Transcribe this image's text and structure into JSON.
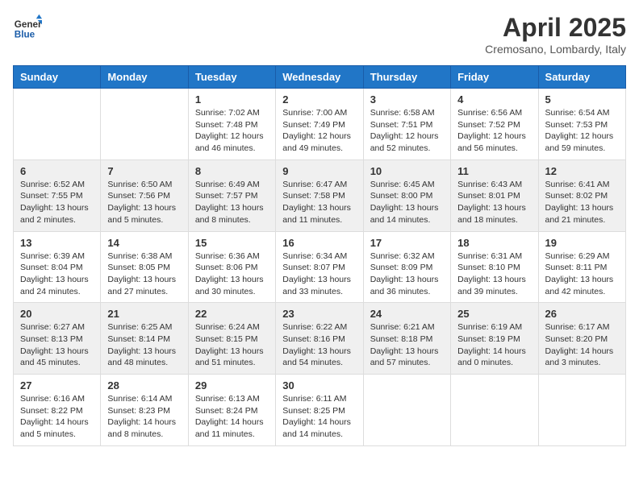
{
  "header": {
    "logo_text_general": "General",
    "logo_text_blue": "Blue",
    "month_title": "April 2025",
    "subtitle": "Cremosano, Lombardy, Italy"
  },
  "days_of_week": [
    "Sunday",
    "Monday",
    "Tuesday",
    "Wednesday",
    "Thursday",
    "Friday",
    "Saturday"
  ],
  "weeks": [
    [
      {
        "day": "",
        "info": ""
      },
      {
        "day": "",
        "info": ""
      },
      {
        "day": "1",
        "info": "Sunrise: 7:02 AM\nSunset: 7:48 PM\nDaylight: 12 hours and 46 minutes."
      },
      {
        "day": "2",
        "info": "Sunrise: 7:00 AM\nSunset: 7:49 PM\nDaylight: 12 hours and 49 minutes."
      },
      {
        "day": "3",
        "info": "Sunrise: 6:58 AM\nSunset: 7:51 PM\nDaylight: 12 hours and 52 minutes."
      },
      {
        "day": "4",
        "info": "Sunrise: 6:56 AM\nSunset: 7:52 PM\nDaylight: 12 hours and 56 minutes."
      },
      {
        "day": "5",
        "info": "Sunrise: 6:54 AM\nSunset: 7:53 PM\nDaylight: 12 hours and 59 minutes."
      }
    ],
    [
      {
        "day": "6",
        "info": "Sunrise: 6:52 AM\nSunset: 7:55 PM\nDaylight: 13 hours and 2 minutes."
      },
      {
        "day": "7",
        "info": "Sunrise: 6:50 AM\nSunset: 7:56 PM\nDaylight: 13 hours and 5 minutes."
      },
      {
        "day": "8",
        "info": "Sunrise: 6:49 AM\nSunset: 7:57 PM\nDaylight: 13 hours and 8 minutes."
      },
      {
        "day": "9",
        "info": "Sunrise: 6:47 AM\nSunset: 7:58 PM\nDaylight: 13 hours and 11 minutes."
      },
      {
        "day": "10",
        "info": "Sunrise: 6:45 AM\nSunset: 8:00 PM\nDaylight: 13 hours and 14 minutes."
      },
      {
        "day": "11",
        "info": "Sunrise: 6:43 AM\nSunset: 8:01 PM\nDaylight: 13 hours and 18 minutes."
      },
      {
        "day": "12",
        "info": "Sunrise: 6:41 AM\nSunset: 8:02 PM\nDaylight: 13 hours and 21 minutes."
      }
    ],
    [
      {
        "day": "13",
        "info": "Sunrise: 6:39 AM\nSunset: 8:04 PM\nDaylight: 13 hours and 24 minutes."
      },
      {
        "day": "14",
        "info": "Sunrise: 6:38 AM\nSunset: 8:05 PM\nDaylight: 13 hours and 27 minutes."
      },
      {
        "day": "15",
        "info": "Sunrise: 6:36 AM\nSunset: 8:06 PM\nDaylight: 13 hours and 30 minutes."
      },
      {
        "day": "16",
        "info": "Sunrise: 6:34 AM\nSunset: 8:07 PM\nDaylight: 13 hours and 33 minutes."
      },
      {
        "day": "17",
        "info": "Sunrise: 6:32 AM\nSunset: 8:09 PM\nDaylight: 13 hours and 36 minutes."
      },
      {
        "day": "18",
        "info": "Sunrise: 6:31 AM\nSunset: 8:10 PM\nDaylight: 13 hours and 39 minutes."
      },
      {
        "day": "19",
        "info": "Sunrise: 6:29 AM\nSunset: 8:11 PM\nDaylight: 13 hours and 42 minutes."
      }
    ],
    [
      {
        "day": "20",
        "info": "Sunrise: 6:27 AM\nSunset: 8:13 PM\nDaylight: 13 hours and 45 minutes."
      },
      {
        "day": "21",
        "info": "Sunrise: 6:25 AM\nSunset: 8:14 PM\nDaylight: 13 hours and 48 minutes."
      },
      {
        "day": "22",
        "info": "Sunrise: 6:24 AM\nSunset: 8:15 PM\nDaylight: 13 hours and 51 minutes."
      },
      {
        "day": "23",
        "info": "Sunrise: 6:22 AM\nSunset: 8:16 PM\nDaylight: 13 hours and 54 minutes."
      },
      {
        "day": "24",
        "info": "Sunrise: 6:21 AM\nSunset: 8:18 PM\nDaylight: 13 hours and 57 minutes."
      },
      {
        "day": "25",
        "info": "Sunrise: 6:19 AM\nSunset: 8:19 PM\nDaylight: 14 hours and 0 minutes."
      },
      {
        "day": "26",
        "info": "Sunrise: 6:17 AM\nSunset: 8:20 PM\nDaylight: 14 hours and 3 minutes."
      }
    ],
    [
      {
        "day": "27",
        "info": "Sunrise: 6:16 AM\nSunset: 8:22 PM\nDaylight: 14 hours and 5 minutes."
      },
      {
        "day": "28",
        "info": "Sunrise: 6:14 AM\nSunset: 8:23 PM\nDaylight: 14 hours and 8 minutes."
      },
      {
        "day": "29",
        "info": "Sunrise: 6:13 AM\nSunset: 8:24 PM\nDaylight: 14 hours and 11 minutes."
      },
      {
        "day": "30",
        "info": "Sunrise: 6:11 AM\nSunset: 8:25 PM\nDaylight: 14 hours and 14 minutes."
      },
      {
        "day": "",
        "info": ""
      },
      {
        "day": "",
        "info": ""
      },
      {
        "day": "",
        "info": ""
      }
    ]
  ]
}
